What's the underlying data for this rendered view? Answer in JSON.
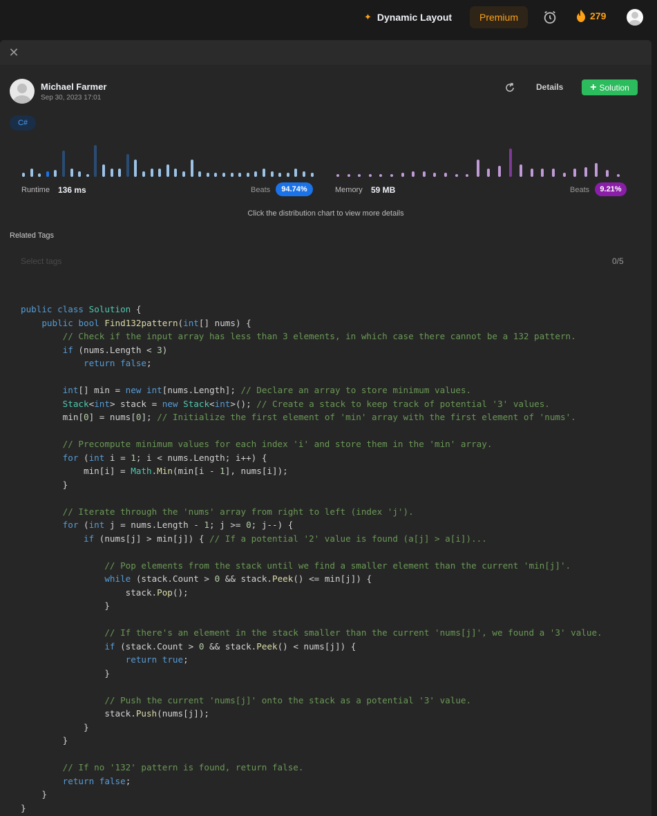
{
  "topbar": {
    "dynamic_layout_label": "Dynamic Layout",
    "premium_label": "Premium",
    "streak_count": "279",
    "accent_color": "#ffa116"
  },
  "submission": {
    "author_name": "Michael Farmer",
    "date": "Sep 30, 2023 17:01",
    "details_label": "Details",
    "solution_label": "Solution",
    "language": "C#"
  },
  "runtime": {
    "label": "Runtime",
    "value": "136 ms",
    "beats_label": "Beats",
    "beats_value": "94.74%",
    "color": "#1a73e8"
  },
  "memory": {
    "label": "Memory",
    "value": "59 MB",
    "beats_label": "Beats",
    "beats_value": "9.21%",
    "color": "#8b1ea8"
  },
  "hint": "Click the distribution chart to view more details",
  "tags": {
    "title": "Related Tags",
    "placeholder": "Select tags",
    "count": "0/5"
  },
  "chart_data": [
    {
      "type": "bar",
      "name": "runtime-distribution",
      "values": [
        6,
        12,
        5,
        8,
        10,
        37,
        12,
        8,
        4,
        45,
        18,
        12,
        12,
        32,
        24,
        8,
        12,
        12,
        18,
        12,
        8,
        24,
        8,
        6,
        6,
        6,
        6,
        6,
        6,
        8,
        12,
        8,
        6,
        6,
        12,
        8,
        6
      ],
      "highlight_index": 3
    },
    {
      "type": "bar",
      "name": "memory-distribution",
      "values": [
        4,
        4,
        4,
        4,
        4,
        4,
        6,
        8,
        8,
        6,
        6,
        4,
        4,
        24,
        12,
        16,
        40,
        18,
        12,
        12,
        12,
        6,
        12,
        14,
        20,
        10,
        4
      ],
      "highlight_index": 16
    }
  ],
  "code_lines": [
    "public class Solution {",
    "    public bool Find132pattern(int[] nums) {",
    "        // Check if the input array has less than 3 elements, in which case there cannot be a 132 pattern.",
    "        if (nums.Length < 3)",
    "            return false;",
    "",
    "        int[] min = new int[nums.Length]; // Declare an array to store minimum values.",
    "        Stack<int> stack = new Stack<int>(); // Create a stack to keep track of potential '3' values.",
    "        min[0] = nums[0]; // Initialize the first element of 'min' array with the first element of 'nums'.",
    "",
    "        // Precompute minimum values for each index 'i' and store them in the 'min' array.",
    "        for (int i = 1; i < nums.Length; i++) {",
    "            min[i] = Math.Min(min[i - 1], nums[i]);",
    "        }",
    "",
    "        // Iterate through the 'nums' array from right to left (index 'j').",
    "        for (int j = nums.Length - 1; j >= 0; j--) {",
    "            if (nums[j] > min[j]) { // If a potential '2' value is found (a[j] > a[i])...",
    "",
    "                // Pop elements from the stack until we find a smaller element than the current 'min[j]'.",
    "                while (stack.Count > 0 && stack.Peek() <= min[j]) {",
    "                    stack.Pop();",
    "                }",
    "",
    "                // If there's an element in the stack smaller than the current 'nums[j]', we found a '3' value.",
    "                if (stack.Count > 0 && stack.Peek() < nums[j]) {",
    "                    return true;",
    "                }",
    "",
    "                // Push the current 'nums[j]' onto the stack as a potential '3' value.",
    "                stack.Push(nums[j]);",
    "            }",
    "        }",
    "",
    "        // If no '132' pattern is found, return false.",
    "        return false;",
    "    }",
    "}"
  ]
}
